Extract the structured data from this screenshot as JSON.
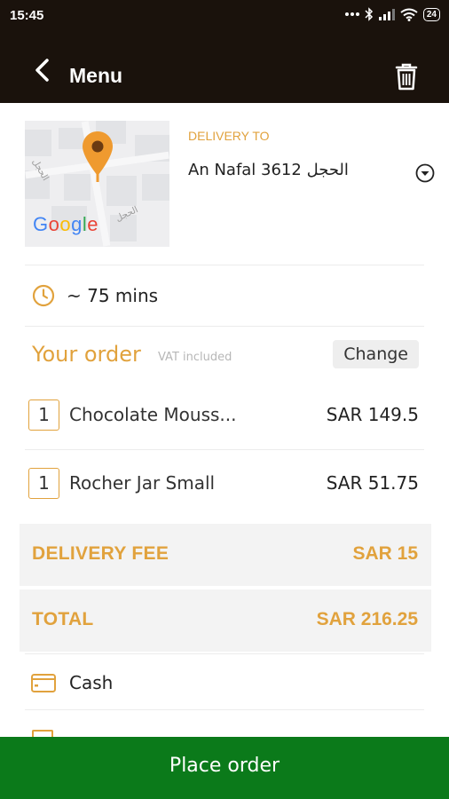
{
  "status_bar": {
    "time": "15:45",
    "battery": "24",
    "icons": [
      "more-dots-icon",
      "bluetooth-icon",
      "signal-icon",
      "wifi-icon",
      "battery-icon"
    ]
  },
  "app_bar": {
    "title": "Menu",
    "back_icon": "chevron-left-icon",
    "action_icon": "trash-icon"
  },
  "delivery": {
    "label": "DELIVERY TO",
    "address": "An Nafal الحجل 3612",
    "map": {
      "logo_text": "Google",
      "street_labels": [
        "الحجل",
        "الحجل"
      ]
    }
  },
  "eta": {
    "text": "~ 75 mins"
  },
  "order": {
    "title": "Your order",
    "vat_note": "VAT included",
    "change_label": "Change",
    "items": [
      {
        "qty": "1",
        "name": "Chocolate Mouss...",
        "price": "SAR 149.5"
      },
      {
        "qty": "1",
        "name": "Rocher Jar Small",
        "price": "SAR 51.75"
      }
    ],
    "delivery_fee": {
      "label": "DELIVERY FEE",
      "value": "SAR 15"
    },
    "total": {
      "label": "TOTAL",
      "value": "SAR 216.25"
    }
  },
  "payment": {
    "methods": [
      {
        "label": "Cash",
        "icon": "wallet-icon"
      }
    ]
  },
  "place_order_label": "Place order",
  "colors": {
    "accent": "#e1a23d",
    "header_bg": "#1a120c",
    "primary_button": "#0b7a1a",
    "fee_bg": "#f3f3f3"
  }
}
